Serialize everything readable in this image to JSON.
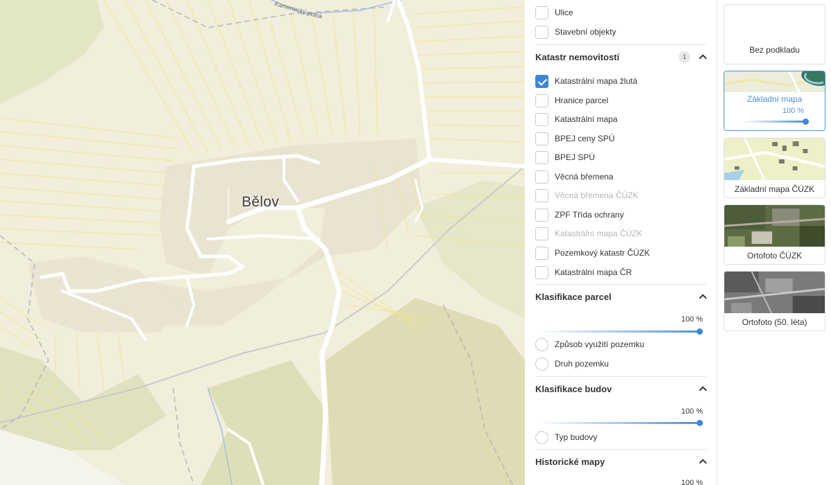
{
  "map": {
    "place_label": "Bělov",
    "stream_label": "Kamenecký potok"
  },
  "panel": {
    "top_layers": [
      {
        "label": "Ulice",
        "checked": false,
        "disabled": false
      },
      {
        "label": "Stavební objekty",
        "checked": false,
        "disabled": false
      }
    ],
    "katastr": {
      "title": "Katastr nemovitostí",
      "badge": "1",
      "items": [
        {
          "label": "Katastrální mapa žlutá",
          "checked": true,
          "disabled": false
        },
        {
          "label": "Hranice parcel",
          "checked": false,
          "disabled": false
        },
        {
          "label": "Katastrální mapa",
          "checked": false,
          "disabled": false
        },
        {
          "label": "BPEJ ceny SPÚ",
          "checked": false,
          "disabled": false
        },
        {
          "label": "BPEJ SPÚ",
          "checked": false,
          "disabled": false
        },
        {
          "label": "Věcná břemena",
          "checked": false,
          "disabled": false
        },
        {
          "label": "Věcná břemena ČÚZK",
          "checked": false,
          "disabled": true
        },
        {
          "label": "ZPF Třída ochrany",
          "checked": false,
          "disabled": false
        },
        {
          "label": "Katastrální mapa ČÚZK",
          "checked": false,
          "disabled": true
        },
        {
          "label": "Pozemkový katastr ČÚZK",
          "checked": false,
          "disabled": false
        },
        {
          "label": "Katastrální mapa ČR",
          "checked": false,
          "disabled": false
        }
      ]
    },
    "klasifikace_parcel": {
      "title": "Klasifikace parcel",
      "opacity": "100 %",
      "options": [
        "Způsob využití pozemku",
        "Druh pozemku"
      ]
    },
    "klasifikace_budov": {
      "title": "Klasifikace budov",
      "opacity": "100 %",
      "options": [
        "Typ budovy"
      ]
    },
    "historicke": {
      "title": "Historické mapy",
      "opacity": "100 %"
    }
  },
  "basemaps": [
    {
      "label": "Bez podkladu",
      "active": false
    },
    {
      "label": "Základní mapa",
      "active": true,
      "opacity": "100 %"
    },
    {
      "label": "Základní mapa ČÚZK",
      "active": false
    },
    {
      "label": "Ortofoto ČÚZK",
      "active": false
    },
    {
      "label": "Ortofoto (50. léta)",
      "active": false
    }
  ],
  "colors": {
    "accent": "#3f86d8",
    "map_background": "#f1eedc",
    "parcel_lines": "#f3e58a"
  }
}
